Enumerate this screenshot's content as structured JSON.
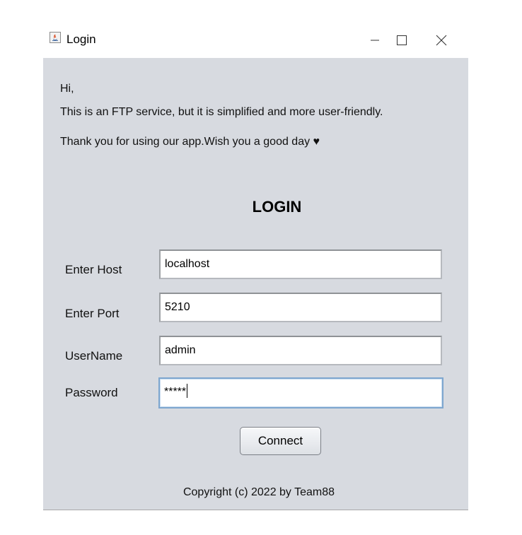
{
  "window": {
    "title": "Login",
    "controls": {
      "minimize": "minimize-icon",
      "maximize": "maximize-icon",
      "close": "close-icon"
    }
  },
  "greeting": {
    "line1": "Hi,",
    "line2": "This is an FTP service, but it is simplified and more user-friendly.",
    "line3": "Thank you for using our app.Wish you a good day ♥"
  },
  "heading": "LOGIN",
  "form": {
    "host": {
      "label": "Enter Host",
      "value": "localhost"
    },
    "port": {
      "label": "Enter Port",
      "value": "5210"
    },
    "username": {
      "label": "UserName",
      "value": "admin"
    },
    "password": {
      "label": "Password",
      "value": "*****"
    }
  },
  "connect_label": "Connect",
  "footer": "Copyright (c) 2022 by Team88",
  "colors": {
    "panel_background": "#d7dae0",
    "focus_border": "#7ea6cf"
  }
}
